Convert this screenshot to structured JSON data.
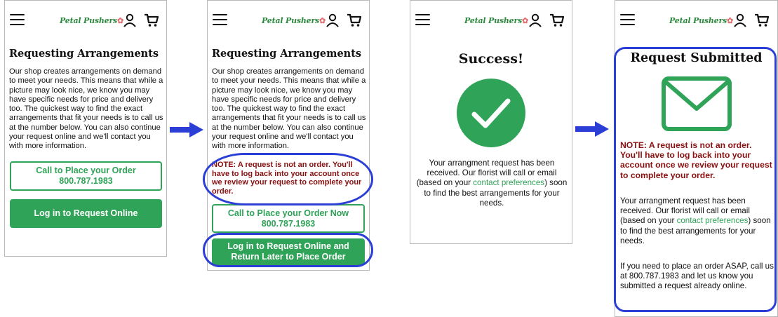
{
  "brand": {
    "logo_text": "Petal Pushers",
    "accent": "#2fa357",
    "note_color": "#8b1010",
    "highlight_color": "#2b3fd6"
  },
  "screen1": {
    "title": "Requesting Arrangements",
    "body": "Our shop creates arrangements on demand to meet your needs. This means that while a picture may look nice, we know you may have specific needs for price and delivery too. The quickest way to find the exact arrangements that fit your needs is to call us at the number below. You can also continue your request online and we'll contact you with more information.",
    "call_line1": "Call to Place your Order",
    "call_line2": "800.787.1983",
    "login_label": "Log in to Request Online"
  },
  "screen2": {
    "title": "Requesting Arrangements",
    "body": "Our shop creates arrangements on demand to meet your needs. This means that while a picture may look nice, we know you may have specific needs for price and delivery too. The quickest way to find the exact arrangements that fit your needs is to call us at the number below. You can also continue your request online and we'll contact you with more information.",
    "note": "NOTE: A request is not an order. You'll have to log back into your account once we review your request to complete your order.",
    "call_line1": "Call to Place your Order Now",
    "call_line2": "800.787.1983",
    "login_line1": "Log in to Request Online and",
    "login_line2": "Return Later to Place Order"
  },
  "screen3": {
    "title": "Success!",
    "icon": "checkmark-circle-icon",
    "text_before": "Your arrangment request has been received. Our florist will call or email (based on your ",
    "link": "contact preferences",
    "text_after": ") soon to find the best arrangements for your needs."
  },
  "screen4": {
    "title": "Request Submitted",
    "icon": "envelope-icon",
    "note": "NOTE: A request is not an order. You'll have to log back into your account once we review your request to complete your order.",
    "text_before": "Your arrangment request has been received. Our florist will call or email (based on your ",
    "link": "contact preferences",
    "text_after": ") soon to find the best arrangements for your needs.",
    "asap": "If you need to place an order ASAP, call us at 800.787.1983 and let us know you submitted a request already online."
  }
}
